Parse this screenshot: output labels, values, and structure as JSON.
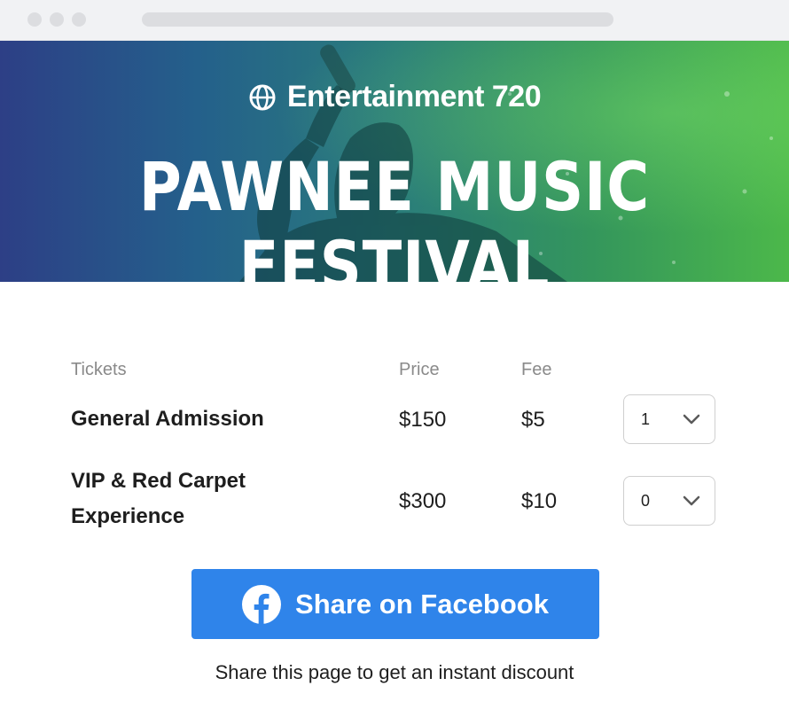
{
  "hero": {
    "brand": "Entertainment 720",
    "brand_icon": "globe-icon",
    "title": "PAWNEE MUSIC FESTIVAL",
    "colors": {
      "left": "#2d3f86",
      "mid": "#2a7d7b",
      "right": "#4cb84a"
    }
  },
  "table": {
    "headers": {
      "tickets": "Tickets",
      "price": "Price",
      "fee": "Fee"
    },
    "rows": [
      {
        "name_line1": "General Admission",
        "name_line2": "",
        "price": "$150",
        "fee": "$5",
        "qty": "1"
      },
      {
        "name_line1": "VIP & Red Carpet",
        "name_line2": "Experience",
        "price": "$300",
        "fee": "$10",
        "qty": "0"
      }
    ]
  },
  "share": {
    "button_label": "Share on Facebook",
    "icon": "facebook-icon",
    "color": "#2f84ea",
    "hint": "Share this page to get an instant discount"
  }
}
